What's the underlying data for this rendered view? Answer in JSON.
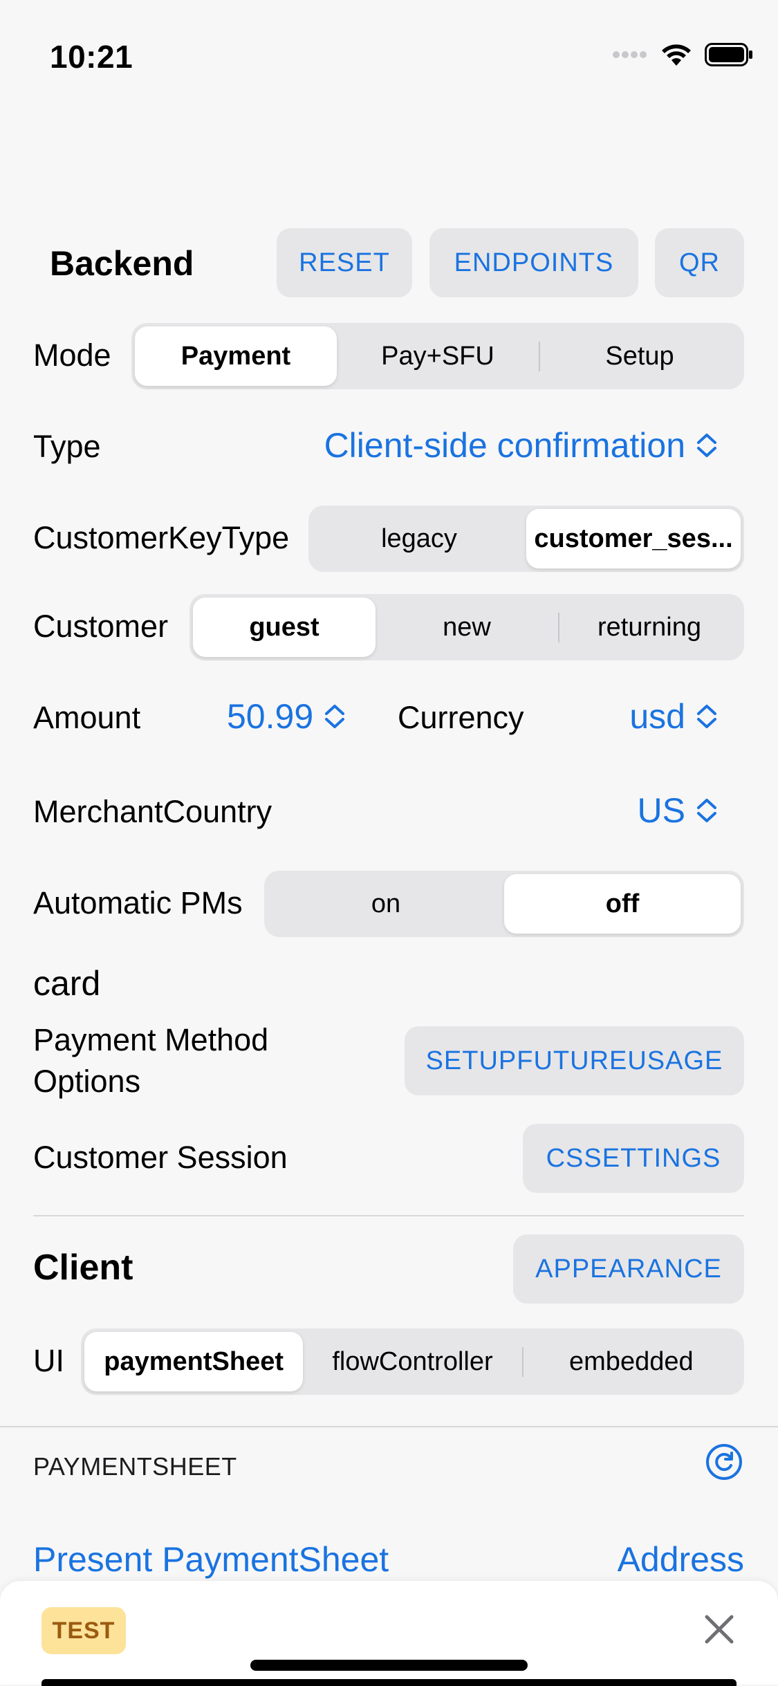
{
  "status": {
    "time": "10:21"
  },
  "backend": {
    "title": "Backend",
    "reset_label": "RESET",
    "endpoints_label": "ENDPOINTS",
    "qr_label": "QR"
  },
  "mode": {
    "label": "Mode",
    "options": [
      "Payment",
      "Pay+SFU",
      "Setup"
    ],
    "selected": "Payment"
  },
  "type": {
    "label": "Type",
    "value": "Client-side confirmation"
  },
  "customer_key_type": {
    "label": "CustomerKeyType",
    "options": [
      "legacy",
      "customer_ses..."
    ],
    "selected": "customer_ses..."
  },
  "customer": {
    "label": "Customer",
    "options": [
      "guest",
      "new",
      "returning"
    ],
    "selected": "guest"
  },
  "amount": {
    "label": "Amount",
    "value": "50.99"
  },
  "currency": {
    "label": "Currency",
    "value": "usd"
  },
  "merchant_country": {
    "label": "MerchantCountry",
    "value": "US"
  },
  "automatic_pms": {
    "label": "Automatic PMs",
    "options": [
      "on",
      "off"
    ],
    "selected": "off"
  },
  "card_label": "card",
  "payment_method_options": {
    "label_line1": "Payment Method",
    "label_line2": "Options",
    "button_label": "SETUPFUTUREUSAGE"
  },
  "customer_session": {
    "label": "Customer Session",
    "button_label": "CSSETTINGS"
  },
  "client": {
    "title": "Client",
    "appearance_label": "APPEARANCE"
  },
  "ui": {
    "label": "UI",
    "options": [
      "paymentSheet",
      "flowController",
      "embedded"
    ],
    "selected": "paymentSheet"
  },
  "payment_sheet_section": {
    "header": "PAYMENTSHEET",
    "present_label": "Present PaymentSheet",
    "address_label": "Address"
  },
  "bottom_sheet": {
    "test_badge": "TEST"
  },
  "colors": {
    "accent": "#1a73e0",
    "background": "#f7f7f7",
    "segment_bg": "#e6e6e8",
    "test_badge_bg": "#fde29a"
  },
  "icons": [
    "wifi-icon",
    "battery-icon",
    "cellular-icon",
    "chevron-updown-icon",
    "refresh-icon",
    "close-icon"
  ]
}
